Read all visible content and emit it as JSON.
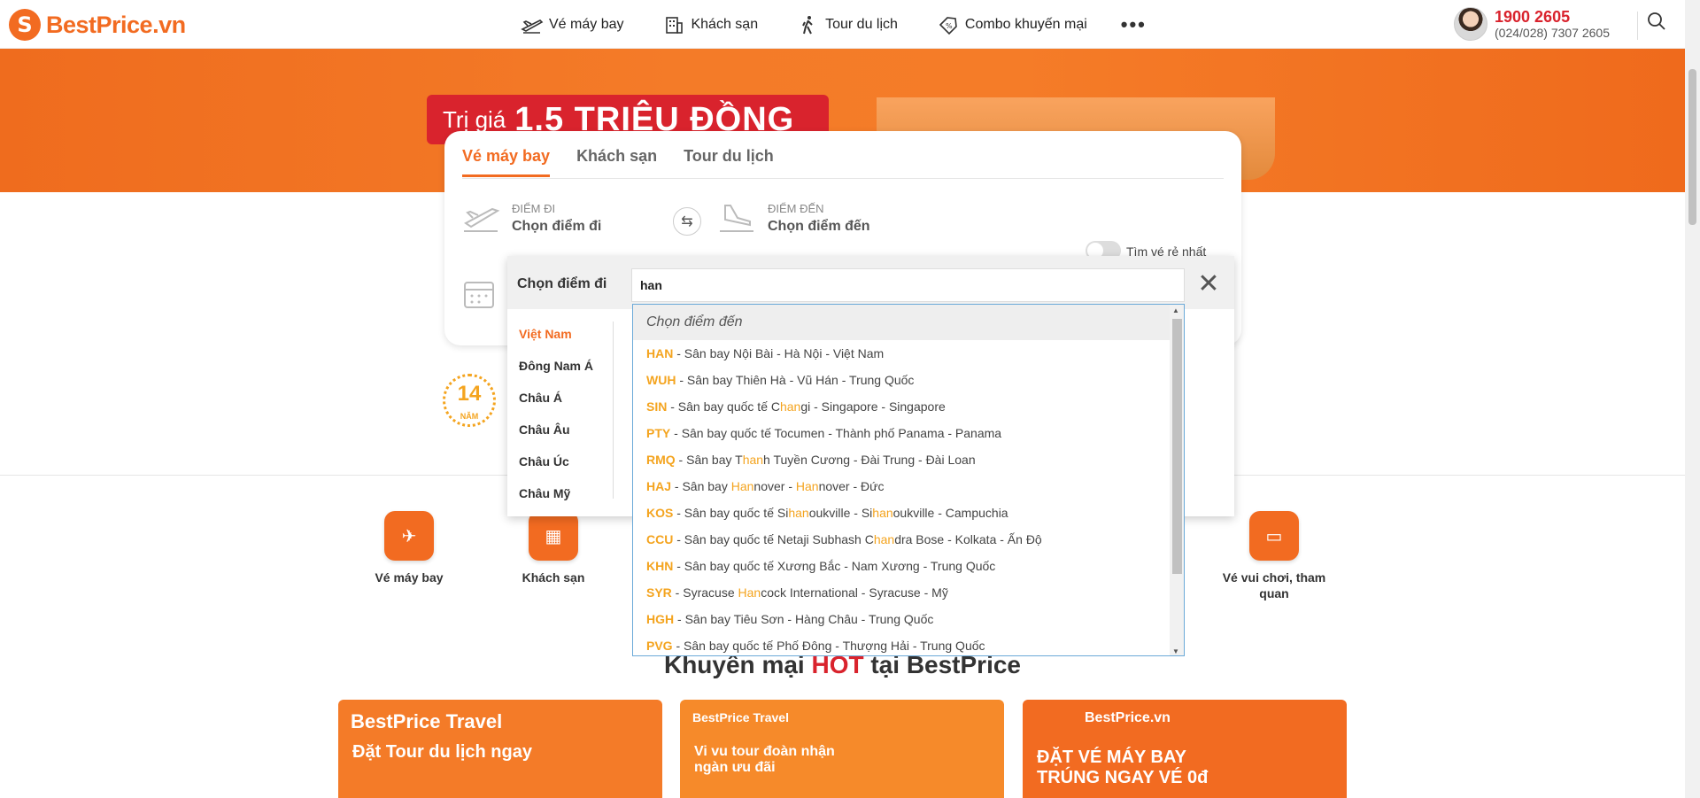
{
  "header": {
    "logo": "BestPrice.vn",
    "nav": [
      {
        "label": "Vé máy bay",
        "icon": "airplane-icon"
      },
      {
        "label": "Khách sạn",
        "icon": "hotel-icon"
      },
      {
        "label": "Tour du lịch",
        "icon": "traveler-icon"
      },
      {
        "label": "Combo khuyến mại",
        "icon": "discount-tag-icon"
      }
    ],
    "more": "•••",
    "hotline": "1900 2605",
    "hotline_sub": "(024/028) 7307 2605"
  },
  "banner": {
    "prefix": "Trị giá",
    "amount": "1.5 TRIỆU ĐỒNG"
  },
  "search_card": {
    "tabs": [
      "Vé máy bay",
      "Khách sạn",
      "Tour du lịch"
    ],
    "active_tab": 0,
    "from_label": "ĐIỂM ĐI",
    "from_value": "Chọn điểm đi",
    "to_label": "ĐIỂM ĐẾN",
    "to_value": "Chọn điểm đến",
    "cheapest_toggle": "Tìm vé rẻ nhất"
  },
  "badge": {
    "number": "14",
    "unit": "NĂM"
  },
  "services": [
    {
      "label": "Vé máy bay"
    },
    {
      "label": "Khách sạn"
    },
    {
      "label": "Vé vui chơi, tham quan"
    }
  ],
  "promo": {
    "title_pre": "Khuyến mại",
    "title_hot": "HOT",
    "title_post": "tại BestPrice",
    "cards": [
      {
        "brand": "BestPrice Travel",
        "text": "Đặt Tour du lịch ngay",
        "color": "#f47b28"
      },
      {
        "brand": "BestPrice Travel",
        "text": "Vi vu tour đoàn nhận ngàn ưu đãi",
        "color": "#f68a2a"
      },
      {
        "brand": "BestPrice.vn",
        "text": "ĐẶT VÉ MÁY BAY TRÚNG NGAY VÉ 0đ",
        "color": "#f26b21"
      }
    ]
  },
  "modal": {
    "title": "Chọn điểm đi",
    "input_value": "han",
    "regions": [
      "Việt Nam",
      "Đông Nam Á",
      "Châu Á",
      "Châu Âu",
      "Châu Úc",
      "Châu Mỹ"
    ],
    "active_region": 0
  },
  "dropdown": {
    "header": "Chọn điểm đến",
    "items": [
      {
        "code": "HAN",
        "parts": [
          "Sân bay Nội Bài - Hà Nội - Việt Nam"
        ]
      },
      {
        "code": "WUH",
        "parts": [
          "Sân bay Thiên Hà - Vũ Hán - Trung Quốc"
        ]
      },
      {
        "code": "SIN",
        "parts": [
          "Sân bay quốc tế C",
          "han",
          "gi - Singapore - Singapore"
        ]
      },
      {
        "code": "PTY",
        "parts": [
          "Sân bay quốc tế Tocumen - Thành phố Panama - Panama"
        ]
      },
      {
        "code": "RMQ",
        "parts": [
          "Sân bay T",
          "han",
          "h Tuyền Cương - Đài Trung - Đài Loan"
        ]
      },
      {
        "code": "HAJ",
        "parts": [
          "Sân bay ",
          "Han",
          "nover - ",
          "Han",
          "nover - Đức"
        ]
      },
      {
        "code": "KOS",
        "parts": [
          "Sân bay quốc tế Si",
          "han",
          "oukville - Si",
          "han",
          "oukville - Campuchia"
        ]
      },
      {
        "code": "CCU",
        "parts": [
          "Sân bay quốc tế Netaji Subhash C",
          "han",
          "dra Bose - Kolkata - Ấn Độ"
        ]
      },
      {
        "code": "KHN",
        "parts": [
          "Sân bay quốc tế Xương Bắc - Nam Xương - Trung Quốc"
        ]
      },
      {
        "code": "SYR",
        "parts": [
          "Syracuse ",
          "Han",
          "cock International - Syracuse - Mỹ"
        ]
      },
      {
        "code": "HGH",
        "parts": [
          "Sân bay Tiêu Sơn - Hàng Châu - Trung Quốc"
        ]
      },
      {
        "code": "PVG",
        "parts": [
          "Sân bay quốc tế Phố Đông - Thượng Hải - Trung Quốc"
        ]
      }
    ]
  },
  "colors": {
    "brand": "#f26b21",
    "highlight": "#f4a41f",
    "hot": "#d9232d"
  }
}
